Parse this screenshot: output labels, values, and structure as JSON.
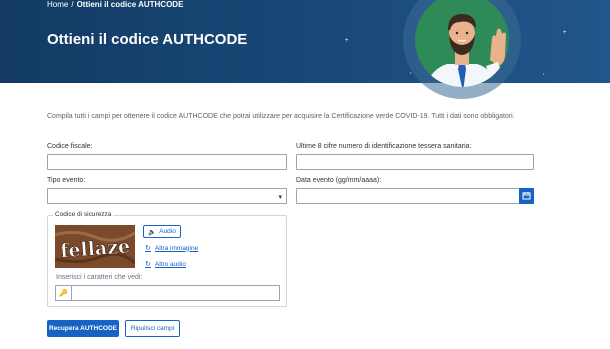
{
  "breadcrumb": {
    "home": "Home",
    "separator": "/",
    "current": "Ottieni il codice AUTHCODE"
  },
  "header": {
    "title": "Ottieni il codice AUTHCODE"
  },
  "intro": "Compila tutti i campi per ottenere il codice AUTHCODE che potrai utilizzare per acquisire la Certificazione verde COVID-19. Tutti i dati sono obbligatori.",
  "form": {
    "codice_fiscale_label": "Codice fiscale:",
    "tessera_label": "Ultime 8 cifre numero di identificazione tessera sanitaria:",
    "tipo_evento_label": "Tipo evento:",
    "data_evento_label": "Data evento (gg/mm/aaaa):"
  },
  "captcha": {
    "legend": "Codice di sicurezza",
    "image_text": "fellaze",
    "audio_label": "Audio",
    "other_image_label": "Altra immagine",
    "other_audio_label": "Altro audio",
    "input_label": "Inserisci i caratteri che vedi:"
  },
  "buttons": {
    "submit": "Recupera AUTHCODE",
    "reset": "Ripulisci campi"
  },
  "icons": {
    "speaker": "speaker-icon",
    "refresh": "refresh-icon",
    "key": "key-icon",
    "calendar": "calendar-icon",
    "chevron": "chevron-down-icon"
  },
  "colors": {
    "primary": "#1763c4",
    "hero": "#1a4a79",
    "avatar_bg": "#2e8b57"
  }
}
